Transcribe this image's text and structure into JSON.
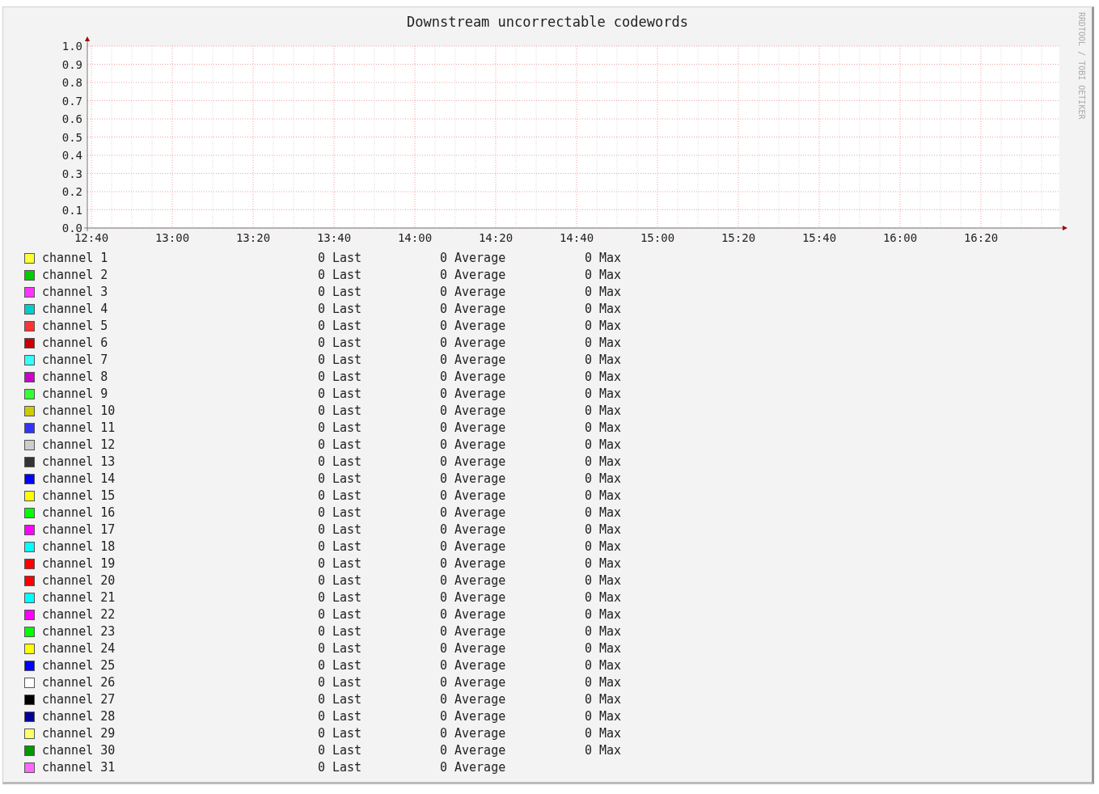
{
  "graph": {
    "title": "Downstream uncorrectable codewords",
    "side_label": "RRDTOOL / TOBI OETIKER",
    "chart_data": {
      "type": "line",
      "grid": true,
      "ylim": [
        0,
        1
      ],
      "categories": [
        "12:40",
        "13:00",
        "13:20",
        "13:40",
        "14:00",
        "14:20",
        "14:40",
        "15:00",
        "15:20",
        "15:40",
        "16:00",
        "16:20"
      ],
      "yticks": [
        {
          "value": 0,
          "label": "0.0"
        },
        {
          "value": 0.1,
          "label": "0.1"
        },
        {
          "value": 0.2,
          "label": "0.2"
        },
        {
          "value": 0.3,
          "label": "0.3"
        },
        {
          "value": 0.4,
          "label": "0.4"
        },
        {
          "value": 0.5,
          "label": "0.5"
        },
        {
          "value": 0.6,
          "label": "0.6"
        },
        {
          "value": 0.7,
          "label": "0.7"
        },
        {
          "value": 0.8,
          "label": "0.8"
        },
        {
          "value": 0.9,
          "label": "0.9"
        },
        {
          "value": 1,
          "label": "1.0"
        }
      ]
    }
  },
  "legend": [
    {
      "name": "channel 1",
      "color": "#ffff33",
      "last": "0",
      "last_label": "Last",
      "average": "0",
      "average_label": "Average",
      "max": "0",
      "max_label": "Max"
    },
    {
      "name": "channel 2",
      "color": "#00cc00",
      "last": "0",
      "last_label": "Last",
      "average": "0",
      "average_label": "Average",
      "max": "0",
      "max_label": "Max"
    },
    {
      "name": "channel 3",
      "color": "#ff33ff",
      "last": "0",
      "last_label": "Last",
      "average": "0",
      "average_label": "Average",
      "max": "0",
      "max_label": "Max"
    },
    {
      "name": "channel 4",
      "color": "#00cccc",
      "last": "0",
      "last_label": "Last",
      "average": "0",
      "average_label": "Average",
      "max": "0",
      "max_label": "Max"
    },
    {
      "name": "channel 5",
      "color": "#ff3333",
      "last": "0",
      "last_label": "Last",
      "average": "0",
      "average_label": "Average",
      "max": "0",
      "max_label": "Max"
    },
    {
      "name": "channel 6",
      "color": "#cc0000",
      "last": "0",
      "last_label": "Last",
      "average": "0",
      "average_label": "Average",
      "max": "0",
      "max_label": "Max"
    },
    {
      "name": "channel 7",
      "color": "#33ffff",
      "last": "0",
      "last_label": "Last",
      "average": "0",
      "average_label": "Average",
      "max": "0",
      "max_label": "Max"
    },
    {
      "name": "channel 8",
      "color": "#cc00cc",
      "last": "0",
      "last_label": "Last",
      "average": "0",
      "average_label": "Average",
      "max": "0",
      "max_label": "Max"
    },
    {
      "name": "channel 9",
      "color": "#33ff33",
      "last": "0",
      "last_label": "Last",
      "average": "0",
      "average_label": "Average",
      "max": "0",
      "max_label": "Max"
    },
    {
      "name": "channel 10",
      "color": "#cccc00",
      "last": "0",
      "last_label": "Last",
      "average": "0",
      "average_label": "Average",
      "max": "0",
      "max_label": "Max"
    },
    {
      "name": "channel 11",
      "color": "#3333ff",
      "last": "0",
      "last_label": "Last",
      "average": "0",
      "average_label": "Average",
      "max": "0",
      "max_label": "Max"
    },
    {
      "name": "channel 12",
      "color": "#cccccc",
      "last": "0",
      "last_label": "Last",
      "average": "0",
      "average_label": "Average",
      "max": "0",
      "max_label": "Max"
    },
    {
      "name": "channel 13",
      "color": "#333333",
      "last": "0",
      "last_label": "Last",
      "average": "0",
      "average_label": "Average",
      "max": "0",
      "max_label": "Max"
    },
    {
      "name": "channel 14",
      "color": "#0000ff",
      "last": "0",
      "last_label": "Last",
      "average": "0",
      "average_label": "Average",
      "max": "0",
      "max_label": "Max"
    },
    {
      "name": "channel 15",
      "color": "#ffff00",
      "last": "0",
      "last_label": "Last",
      "average": "0",
      "average_label": "Average",
      "max": "0",
      "max_label": "Max"
    },
    {
      "name": "channel 16",
      "color": "#00ff00",
      "last": "0",
      "last_label": "Last",
      "average": "0",
      "average_label": "Average",
      "max": "0",
      "max_label": "Max"
    },
    {
      "name": "channel 17",
      "color": "#ff00ff",
      "last": "0",
      "last_label": "Last",
      "average": "0",
      "average_label": "Average",
      "max": "0",
      "max_label": "Max"
    },
    {
      "name": "channel 18",
      "color": "#00ffff",
      "last": "0",
      "last_label": "Last",
      "average": "0",
      "average_label": "Average",
      "max": "0",
      "max_label": "Max"
    },
    {
      "name": "channel 19",
      "color": "#ff0000",
      "last": "0",
      "last_label": "Last",
      "average": "0",
      "average_label": "Average",
      "max": "0",
      "max_label": "Max"
    },
    {
      "name": "channel 20",
      "color": "#ff0000",
      "last": "0",
      "last_label": "Last",
      "average": "0",
      "average_label": "Average",
      "max": "0",
      "max_label": "Max"
    },
    {
      "name": "channel 21",
      "color": "#00ffff",
      "last": "0",
      "last_label": "Last",
      "average": "0",
      "average_label": "Average",
      "max": "0",
      "max_label": "Max"
    },
    {
      "name": "channel 22",
      "color": "#ff00ff",
      "last": "0",
      "last_label": "Last",
      "average": "0",
      "average_label": "Average",
      "max": "0",
      "max_label": "Max"
    },
    {
      "name": "channel 23",
      "color": "#00ff00",
      "last": "0",
      "last_label": "Last",
      "average": "0",
      "average_label": "Average",
      "max": "0",
      "max_label": "Max"
    },
    {
      "name": "channel 24",
      "color": "#ffff00",
      "last": "0",
      "last_label": "Last",
      "average": "0",
      "average_label": "Average",
      "max": "0",
      "max_label": "Max"
    },
    {
      "name": "channel 25",
      "color": "#0000ff",
      "last": "0",
      "last_label": "Last",
      "average": "0",
      "average_label": "Average",
      "max": "0",
      "max_label": "Max"
    },
    {
      "name": "channel 26",
      "color": "#ffffff",
      "last": "0",
      "last_label": "Last",
      "average": "0",
      "average_label": "Average",
      "max": "0",
      "max_label": "Max"
    },
    {
      "name": "channel 27",
      "color": "#000000",
      "last": "0",
      "last_label": "Last",
      "average": "0",
      "average_label": "Average",
      "max": "0",
      "max_label": "Max"
    },
    {
      "name": "channel 28",
      "color": "#000099",
      "last": "0",
      "last_label": "Last",
      "average": "0",
      "average_label": "Average",
      "max": "0",
      "max_label": "Max"
    },
    {
      "name": "channel 29",
      "color": "#ffff66",
      "last": "0",
      "last_label": "Last",
      "average": "0",
      "average_label": "Average",
      "max": "0",
      "max_label": "Max"
    },
    {
      "name": "channel 30",
      "color": "#009900",
      "last": "0",
      "last_label": "Last",
      "average": "0",
      "average_label": "Average",
      "max": "0",
      "max_label": "Max"
    },
    {
      "name": "channel 31",
      "color": "#ff66ff",
      "last": "0",
      "last_label": "Last",
      "average": "0",
      "average_label": "Average"
    }
  ]
}
